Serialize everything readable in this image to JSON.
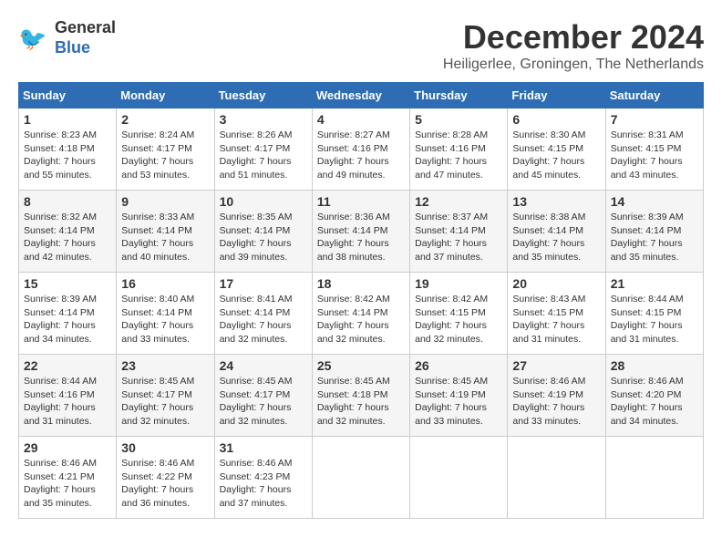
{
  "header": {
    "logo_line1": "General",
    "logo_line2": "Blue",
    "month_title": "December 2024",
    "location": "Heiligerlee, Groningen, The Netherlands"
  },
  "days_of_week": [
    "Sunday",
    "Monday",
    "Tuesday",
    "Wednesday",
    "Thursday",
    "Friday",
    "Saturday"
  ],
  "weeks": [
    [
      {
        "day": "1",
        "sunrise": "8:23 AM",
        "sunset": "4:18 PM",
        "daylight": "7 hours and 55 minutes."
      },
      {
        "day": "2",
        "sunrise": "8:24 AM",
        "sunset": "4:17 PM",
        "daylight": "7 hours and 53 minutes."
      },
      {
        "day": "3",
        "sunrise": "8:26 AM",
        "sunset": "4:17 PM",
        "daylight": "7 hours and 51 minutes."
      },
      {
        "day": "4",
        "sunrise": "8:27 AM",
        "sunset": "4:16 PM",
        "daylight": "7 hours and 49 minutes."
      },
      {
        "day": "5",
        "sunrise": "8:28 AM",
        "sunset": "4:16 PM",
        "daylight": "7 hours and 47 minutes."
      },
      {
        "day": "6",
        "sunrise": "8:30 AM",
        "sunset": "4:15 PM",
        "daylight": "7 hours and 45 minutes."
      },
      {
        "day": "7",
        "sunrise": "8:31 AM",
        "sunset": "4:15 PM",
        "daylight": "7 hours and 43 minutes."
      }
    ],
    [
      {
        "day": "8",
        "sunrise": "8:32 AM",
        "sunset": "4:14 PM",
        "daylight": "7 hours and 42 minutes."
      },
      {
        "day": "9",
        "sunrise": "8:33 AM",
        "sunset": "4:14 PM",
        "daylight": "7 hours and 40 minutes."
      },
      {
        "day": "10",
        "sunrise": "8:35 AM",
        "sunset": "4:14 PM",
        "daylight": "7 hours and 39 minutes."
      },
      {
        "day": "11",
        "sunrise": "8:36 AM",
        "sunset": "4:14 PM",
        "daylight": "7 hours and 38 minutes."
      },
      {
        "day": "12",
        "sunrise": "8:37 AM",
        "sunset": "4:14 PM",
        "daylight": "7 hours and 37 minutes."
      },
      {
        "day": "13",
        "sunrise": "8:38 AM",
        "sunset": "4:14 PM",
        "daylight": "7 hours and 35 minutes."
      },
      {
        "day": "14",
        "sunrise": "8:39 AM",
        "sunset": "4:14 PM",
        "daylight": "7 hours and 35 minutes."
      }
    ],
    [
      {
        "day": "15",
        "sunrise": "8:39 AM",
        "sunset": "4:14 PM",
        "daylight": "7 hours and 34 minutes."
      },
      {
        "day": "16",
        "sunrise": "8:40 AM",
        "sunset": "4:14 PM",
        "daylight": "7 hours and 33 minutes."
      },
      {
        "day": "17",
        "sunrise": "8:41 AM",
        "sunset": "4:14 PM",
        "daylight": "7 hours and 32 minutes."
      },
      {
        "day": "18",
        "sunrise": "8:42 AM",
        "sunset": "4:14 PM",
        "daylight": "7 hours and 32 minutes."
      },
      {
        "day": "19",
        "sunrise": "8:42 AM",
        "sunset": "4:15 PM",
        "daylight": "7 hours and 32 minutes."
      },
      {
        "day": "20",
        "sunrise": "8:43 AM",
        "sunset": "4:15 PM",
        "daylight": "7 hours and 31 minutes."
      },
      {
        "day": "21",
        "sunrise": "8:44 AM",
        "sunset": "4:15 PM",
        "daylight": "7 hours and 31 minutes."
      }
    ],
    [
      {
        "day": "22",
        "sunrise": "8:44 AM",
        "sunset": "4:16 PM",
        "daylight": "7 hours and 31 minutes."
      },
      {
        "day": "23",
        "sunrise": "8:45 AM",
        "sunset": "4:17 PM",
        "daylight": "7 hours and 32 minutes."
      },
      {
        "day": "24",
        "sunrise": "8:45 AM",
        "sunset": "4:17 PM",
        "daylight": "7 hours and 32 minutes."
      },
      {
        "day": "25",
        "sunrise": "8:45 AM",
        "sunset": "4:18 PM",
        "daylight": "7 hours and 32 minutes."
      },
      {
        "day": "26",
        "sunrise": "8:45 AM",
        "sunset": "4:19 PM",
        "daylight": "7 hours and 33 minutes."
      },
      {
        "day": "27",
        "sunrise": "8:46 AM",
        "sunset": "4:19 PM",
        "daylight": "7 hours and 33 minutes."
      },
      {
        "day": "28",
        "sunrise": "8:46 AM",
        "sunset": "4:20 PM",
        "daylight": "7 hours and 34 minutes."
      }
    ],
    [
      {
        "day": "29",
        "sunrise": "8:46 AM",
        "sunset": "4:21 PM",
        "daylight": "7 hours and 35 minutes."
      },
      {
        "day": "30",
        "sunrise": "8:46 AM",
        "sunset": "4:22 PM",
        "daylight": "7 hours and 36 minutes."
      },
      {
        "day": "31",
        "sunrise": "8:46 AM",
        "sunset": "4:23 PM",
        "daylight": "7 hours and 37 minutes."
      },
      null,
      null,
      null,
      null
    ]
  ]
}
